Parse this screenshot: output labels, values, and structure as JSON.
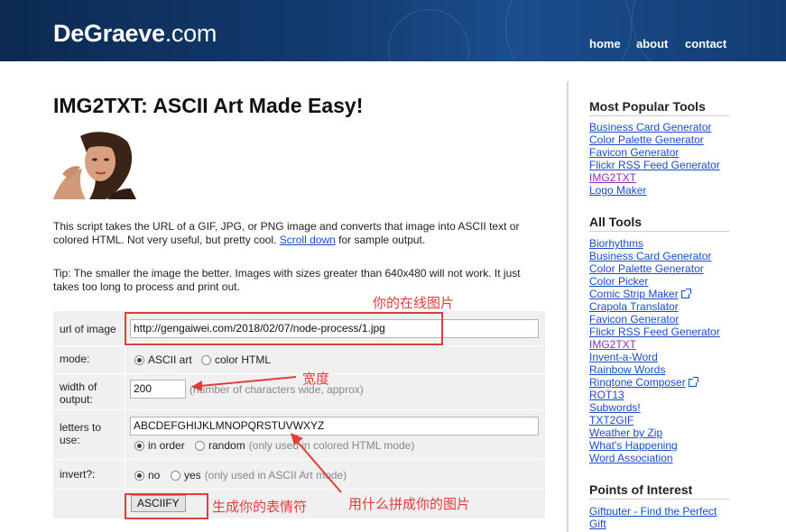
{
  "header": {
    "logo_bold": "DeGraeve",
    "logo_rest": ".com",
    "nav": [
      "home",
      "about",
      "contact"
    ]
  },
  "main": {
    "title": "IMG2TXT: ASCII Art Made Easy!",
    "intro_before_link": "This script takes the URL of a GIF, JPG, or PNG image and converts that image into ASCII text or colored HTML. Not very useful, but pretty cool.",
    "intro_link": "Scroll down",
    "intro_after_link": "for sample output.",
    "tip": "Tip: The smaller the image the better. Images with sizes greater than 640x480 will not work. It just takes too long to process and print out."
  },
  "form": {
    "url_label": "url of image",
    "url_value": "http://gengaiwei.com/2018/02/07/node-process/1.jpg",
    "mode_label": "mode:",
    "mode_options": [
      "ASCII art",
      "color HTML"
    ],
    "mode_selected": "ASCII art",
    "width_label": "width of output:",
    "width_value": "200",
    "width_hint": "(number of characters wide, approx)",
    "letters_label": "letters to use:",
    "letters_value": "ABCDEFGHIJKLMNOPQRSTUVWXYZ",
    "order_options": [
      "in order",
      "random"
    ],
    "order_selected": "in order",
    "order_hint": "(only used in colored HTML mode)",
    "invert_label": "invert?:",
    "invert_options": [
      "no",
      "yes"
    ],
    "invert_selected": "no",
    "invert_hint": "(only used in ASCII Art mode)",
    "submit_label": "ASCIIFY"
  },
  "annotations": {
    "url_note": "你的在线图片",
    "width_note": "宽度",
    "letters_note": "用什么拼成你的图片",
    "submit_note": "生成你的表情符",
    "color": "#e23c3c"
  },
  "sidebar": {
    "popular_title": "Most Popular Tools",
    "popular": [
      {
        "label": "Business Card Generator",
        "visited": false
      },
      {
        "label": "Color Palette Generator",
        "visited": false
      },
      {
        "label": "Favicon Generator",
        "visited": false
      },
      {
        "label": "Flickr RSS Feed Generator",
        "visited": false
      },
      {
        "label": "IMG2TXT",
        "visited": true
      },
      {
        "label": "Logo Maker",
        "visited": false
      }
    ],
    "all_title": "All Tools",
    "all": [
      {
        "label": "Biorhythms",
        "visited": false,
        "external": false
      },
      {
        "label": "Business Card Generator",
        "visited": false,
        "external": false
      },
      {
        "label": "Color Palette Generator",
        "visited": false,
        "external": false
      },
      {
        "label": "Color Picker",
        "visited": false,
        "external": false
      },
      {
        "label": "Comic Strip Maker",
        "visited": false,
        "external": true
      },
      {
        "label": "Crapola Translator",
        "visited": false,
        "external": false
      },
      {
        "label": "Favicon Generator",
        "visited": false,
        "external": false
      },
      {
        "label": "Flickr RSS Feed Generator",
        "visited": false,
        "external": false
      },
      {
        "label": "IMG2TXT",
        "visited": true,
        "external": false
      },
      {
        "label": "Invent-a-Word",
        "visited": false,
        "external": false
      },
      {
        "label": "Rainbow Words",
        "visited": false,
        "external": false
      },
      {
        "label": "Ringtone Composer",
        "visited": false,
        "external": true
      },
      {
        "label": "ROT13",
        "visited": false,
        "external": false
      },
      {
        "label": "Subwords!",
        "visited": false,
        "external": false
      },
      {
        "label": "TXT2GIF",
        "visited": false,
        "external": false
      },
      {
        "label": "Weather by Zip",
        "visited": false,
        "external": false
      },
      {
        "label": "What's Happening",
        "visited": false,
        "external": false
      },
      {
        "label": "Word Association",
        "visited": false,
        "external": false
      }
    ],
    "poi_title": "Points of Interest",
    "poi": [
      {
        "label": "Giftputer - Find the Perfect Gift"
      }
    ]
  }
}
